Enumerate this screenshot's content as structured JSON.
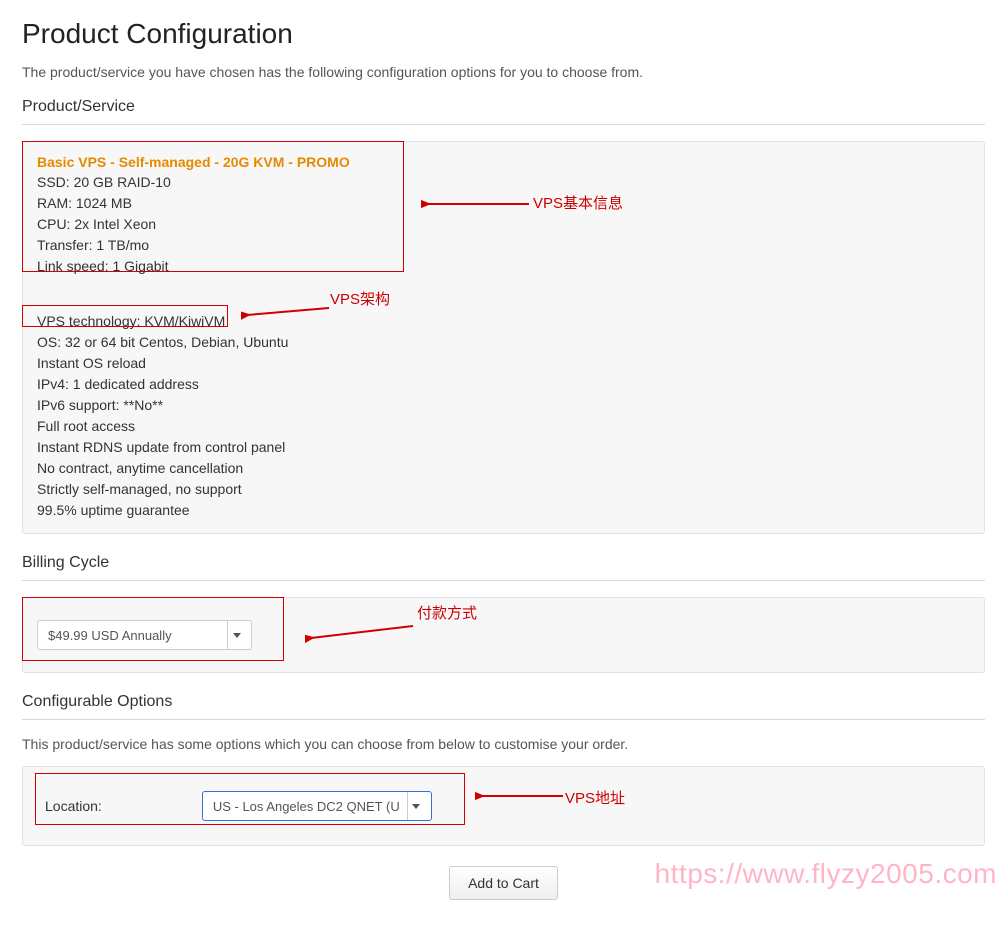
{
  "header": {
    "title": "Product Configuration",
    "description": "The product/service you have chosen has the following configuration options for you to choose from."
  },
  "product_section": {
    "label": "Product/Service",
    "product_title": "Basic VPS - Self-managed - 20G KVM - PROMO",
    "specs_block1": [
      "SSD: 20 GB RAID-10",
      "RAM: 1024 MB",
      "CPU: 2x Intel Xeon",
      "Transfer: 1 TB/mo",
      "Link speed: 1 Gigabit"
    ],
    "tech_line": "VPS technology: KVM/KiwiVM",
    "specs_block2": [
      "OS: 32 or 64 bit Centos, Debian, Ubuntu",
      "Instant OS reload",
      "IPv4: 1 dedicated address",
      "IPv6 support: **No**",
      "Full root access",
      "Instant RDNS update from control panel",
      "No contract, anytime cancellation",
      "Strictly self-managed, no support",
      "99.5% uptime guarantee"
    ]
  },
  "billing_section": {
    "label": "Billing Cycle",
    "selected": "$49.99 USD Annually"
  },
  "config_section": {
    "label": "Configurable Options",
    "description": "This product/service has some options which you can choose from below to customise your order.",
    "location_label": "Location:",
    "location_selected": "US - Los Angeles DC2 QNET (U"
  },
  "buttons": {
    "add_to_cart": "Add to Cart"
  },
  "annotations": {
    "vps_basic": "VPS基本信息",
    "vps_arch": "VPS架构",
    "payment": "付款方式",
    "vps_addr": "VPS地址"
  },
  "watermark": "https://www.flyzy2005.com",
  "arrow_color": "#d10000"
}
